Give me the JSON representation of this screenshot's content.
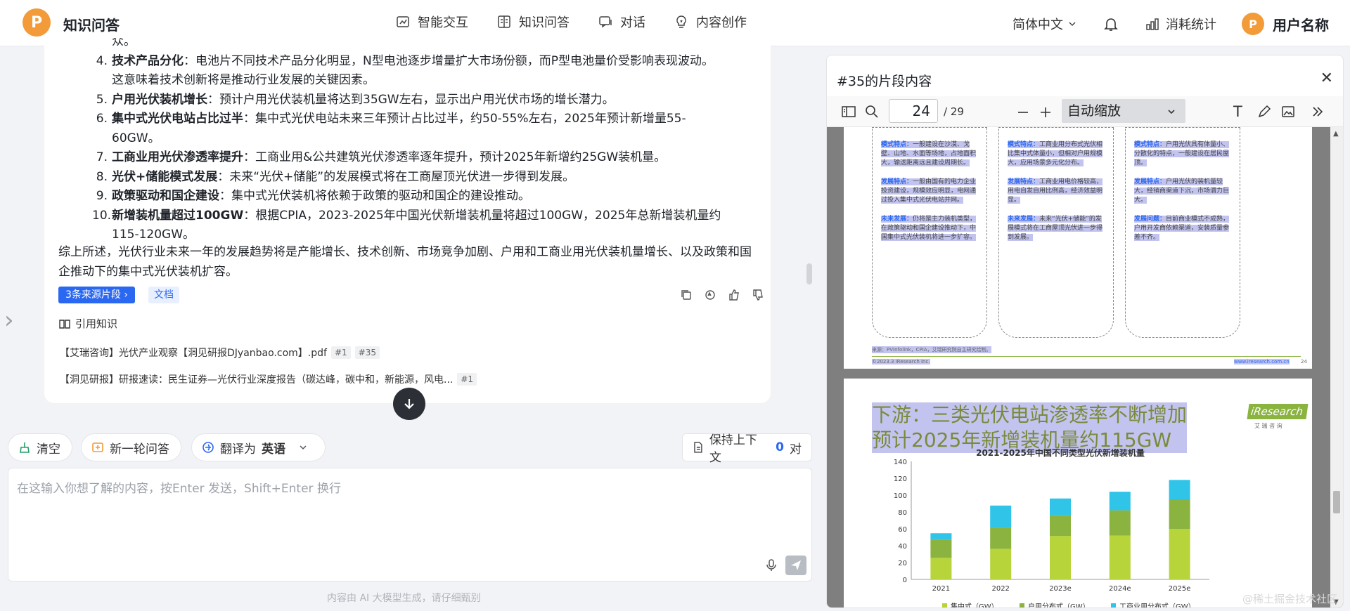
{
  "header": {
    "logo_letter": "P",
    "app_title": "知识问答",
    "nav": [
      {
        "label": "智能交互",
        "icon": "interaction-icon"
      },
      {
        "label": "知识问答",
        "icon": "book-icon"
      },
      {
        "label": "对话",
        "icon": "chat-icon"
      },
      {
        "label": "内容创作",
        "icon": "bulb-icon"
      }
    ],
    "language": "简体中文",
    "stats_label": "消耗统计",
    "avatar_letter": "P",
    "username": "用户名称"
  },
  "answer": {
    "top_fragment": "众。",
    "items": [
      {
        "num": "4.",
        "title": "技术产品分化",
        "text": "：电池片不同技术产品分化明显，N型电池逐步增量扩大市场份额，而P型电池量价受影响表现波动。这意味着技术创新将是推动行业发展的关键因素。"
      },
      {
        "num": "5.",
        "title": "户用光伏装机增长",
        "text": "：预计户用光伏装机量将达到35GW左右，显示出户用光伏市场的增长潜力。"
      },
      {
        "num": "6.",
        "title": "集中式光伏电站占比过半",
        "text": "：集中式光伏电站未来三年预计占比过半，约50-55%左右，2025年预计新增量55-60GW。"
      },
      {
        "num": "7.",
        "title": "工商业用光伏渗透率提升",
        "text": "：工商业用&公共建筑光伏渗透率逐年提升，预计2025年新增约25GW装机量。"
      },
      {
        "num": "8.",
        "title": "光伏+储能模式发展",
        "text": "：未来“光伏+储能”的发展模式将在工商屋顶光伏进一步得到发展。"
      },
      {
        "num": "9.",
        "title": "政策驱动和国企建设",
        "text": "：集中式光伏装机将依赖于政策的驱动和国企的建设推动。"
      },
      {
        "num": "10.",
        "title": "新增装机量超过100GW",
        "text": "：根据CPIA，2023-2025年中国光伏新增装机量将超过100GW，2025年总新增装机量约115-120GW。"
      }
    ],
    "summary": "综上所述，光伏行业未来一年的发展趋势将是产能增长、技术创新、市场竞争加剧、户用和工商业用光伏装机量增长、以及政策和国企推动下的集中式光伏装机扩容。",
    "source_btn": "3条来源片段 ›",
    "doc_tag": "文档",
    "cite_header": "引用知识",
    "citations": [
      {
        "text": "【艾瑞咨询】光伏产业观察【洞见研报DJyanbao.com】.pdf",
        "tags": [
          "#1",
          "#35"
        ]
      },
      {
        "text": "【洞见研报】研报速读：民生证券—光伏行业深度报告（碳达峰，碳中和，新能源，风电...",
        "tags": [
          "#1"
        ]
      }
    ]
  },
  "toolbar": {
    "clear": "清空",
    "new_round": "新一轮问答",
    "translate_label": "翻译为",
    "translate_lang": "英语",
    "keep_context": "保持上下文",
    "context_count": "0",
    "context_unit": "对"
  },
  "input": {
    "placeholder": "在这输入你想了解的内容，按Enter 发送，Shift+Enter 换行"
  },
  "footer": "内容由 AI 大模型生成，请仔细甄别",
  "preview": {
    "title": "#35的片段内容",
    "page": "24",
    "total": "/ 29",
    "zoom": "自动缩放",
    "page24": {
      "cards": [
        {
          "h1": "模式特点：",
          "t1": "一般建设在沙漠、戈壁、山地、水面等场地，占地面积大，输送距离远且建设周期长。",
          "h2": "发展特点：",
          "t2": "一般由国有的电力企业投资建设，规模效应明显，电网通过投入集中式光伏电站并网。",
          "h3": "未来发展：",
          "t3": "仍将是主力装机类型，在政策驱动和国企建设推动下，中国集中式光伏装机将进一步扩容。"
        },
        {
          "h1": "模式特点：",
          "t1": "工商业用分布式光伏相比集中式体量小，但相对户用规模大，应用场景多元化分布。",
          "h2": "发展特点：",
          "t2": "工商业用电价格较高，用电自发自用比例高，经济效益明显。",
          "h3": "未来发展：",
          "t3": "未来“光伏+储能”的发展模式将在工商屋顶光伏进一步得到发展。"
        },
        {
          "h1": "模式特点：",
          "t1": "户用光伏具有体量小、分散化的特点，一般建设在居民屋顶。",
          "h2": "发展特点：",
          "t2": "户用光伏的装机量较大，经销商渠道下沉，市场潜力巨大。",
          "h3": "发展问题：",
          "t3": "目前商业模式不成熟，户用开发商依赖渠道，安装质量参差不齐。"
        }
      ],
      "source_note": "来源：PVInfolink，CPIA，艾瑞研究院自主研究绘制。",
      "copyright": "©2023.3 iResearch Inc.",
      "site": "www.iresearch.com.cn",
      "page_no": "24"
    },
    "page25": {
      "heading_line1": "下游：三类光伏电站渗透率不断增加",
      "heading_line2": "预计2025年新增装机量约115GW",
      "brand": "iResearch",
      "brand_sub": "艾 瑞 咨 询"
    }
  },
  "chart_data": {
    "type": "bar",
    "title": "2021-2025年中国不同类型光伏新增装机量",
    "categories": [
      "2021",
      "2022",
      "2023e",
      "2024e",
      "2025e"
    ],
    "stacked": true,
    "ylim": [
      0,
      140
    ],
    "yticks": [
      0,
      20,
      40,
      60,
      80,
      100,
      120,
      140
    ],
    "series": [
      {
        "name": "集中式（GW）",
        "color": "#b7d43a",
        "values": [
          25.6,
          36.3,
          51.5,
          52.0,
          60.0
        ]
      },
      {
        "name": "户用分布式（GW）",
        "color": "#8ab340",
        "values": [
          21.6,
          25.3,
          25.0,
          30.0,
          35.0
        ]
      },
      {
        "name": "工商业用分布式（GW）",
        "color": "#2fc4e8",
        "values": [
          7.6,
          26.0,
          19.5,
          22.0,
          23.0
        ]
      }
    ]
  },
  "watermark": "@稀土掘金技术社区",
  "colors": {
    "brand": "#f29b38",
    "accent": "#2b68f2",
    "highlight": "#787ddc"
  }
}
